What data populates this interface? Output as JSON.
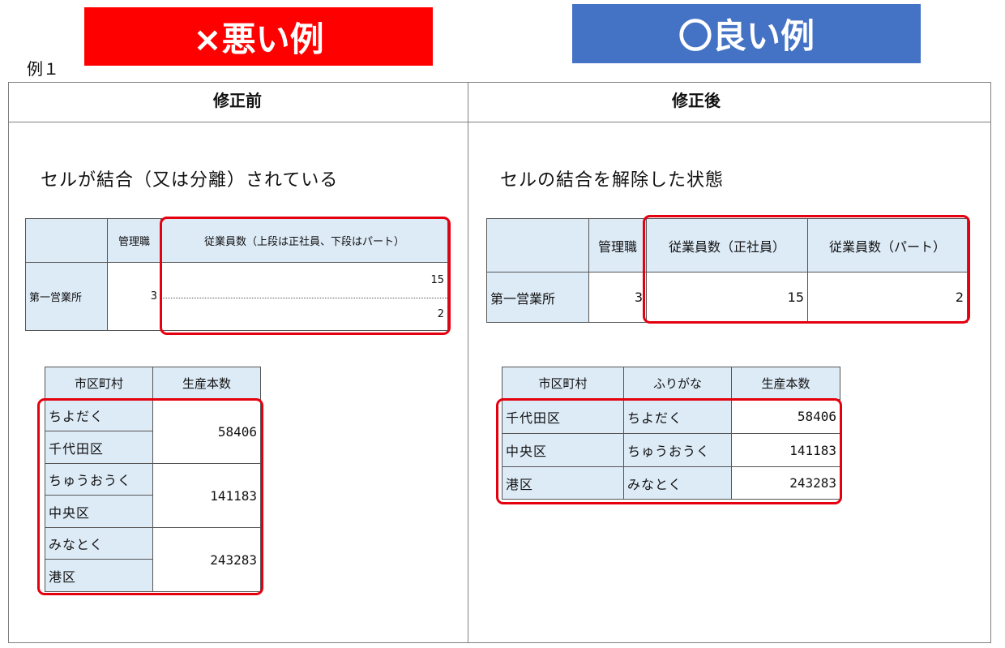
{
  "banners": {
    "bad": "×悪い例",
    "good": "〇良い例"
  },
  "example_label": "例１",
  "headers": {
    "before": "修正前",
    "after": "修正後"
  },
  "captions": {
    "before": "セルが結合（又は分離）されている",
    "after": "セルの結合を解除した状態"
  },
  "staff_before": {
    "col_manager": "管理職",
    "col_staff": "従業員数（上段は正社員、下段はパート）",
    "row_name": "第一営業所",
    "manager": "3",
    "regular": "15",
    "part": "2"
  },
  "staff_after": {
    "col_manager": "管理職",
    "col_regular": "従業員数（正社員）",
    "col_part": "従業員数（パート）",
    "row_name": "第一営業所",
    "manager": "3",
    "regular": "15",
    "part": "2"
  },
  "city_before": {
    "col_city": "市区町村",
    "col_output": "生産本数",
    "rows": [
      {
        "kana": "ちよだく",
        "name": "千代田区",
        "output": "58406"
      },
      {
        "kana": "ちゅうおうく",
        "name": "中央区",
        "output": "141183"
      },
      {
        "kana": "みなとく",
        "name": "港区",
        "output": "243283"
      }
    ]
  },
  "city_after": {
    "col_city": "市区町村",
    "col_kana": "ふりがな",
    "col_output": "生産本数",
    "rows": [
      {
        "name": "千代田区",
        "kana": "ちよだく",
        "output": "58406"
      },
      {
        "name": "中央区",
        "kana": "ちゅうおうく",
        "output": "141183"
      },
      {
        "name": "港区",
        "kana": "みなとく",
        "output": "243283"
      }
    ]
  },
  "colors": {
    "bad": "#ff0000",
    "good": "#4472c4",
    "highlight": "#e5000f",
    "cell_fill": "#ddebf7"
  }
}
